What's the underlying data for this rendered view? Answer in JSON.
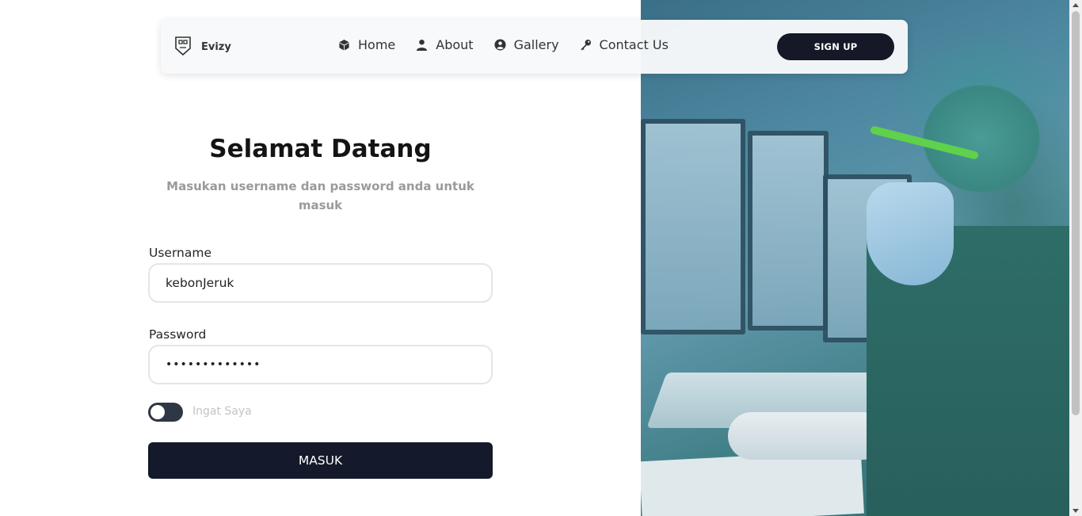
{
  "brand": {
    "name": "Evizy",
    "icon": "shield-logo-icon"
  },
  "nav": {
    "items": [
      {
        "label": "Home",
        "icon": "cube-icon"
      },
      {
        "label": "About",
        "icon": "user-icon"
      },
      {
        "label": "Gallery",
        "icon": "user-circle-icon"
      },
      {
        "label": "Contact Us",
        "icon": "key-icon"
      }
    ],
    "signup_label": "SIGN UP"
  },
  "login": {
    "title": "Selamat Datang",
    "subtitle": "Masukan username dan password anda untuk masuk",
    "username_label": "Username",
    "username_value": "kebonJeruk",
    "password_label": "Password",
    "password_value": "•••••••••••••",
    "remember_label": "Ingat Saya",
    "remember_checked": false,
    "submit_label": "MASUK"
  },
  "colors": {
    "primary_dark": "#141a2b",
    "muted_text": "#9a9a9a",
    "hero_tint": "#4f8aa3"
  }
}
